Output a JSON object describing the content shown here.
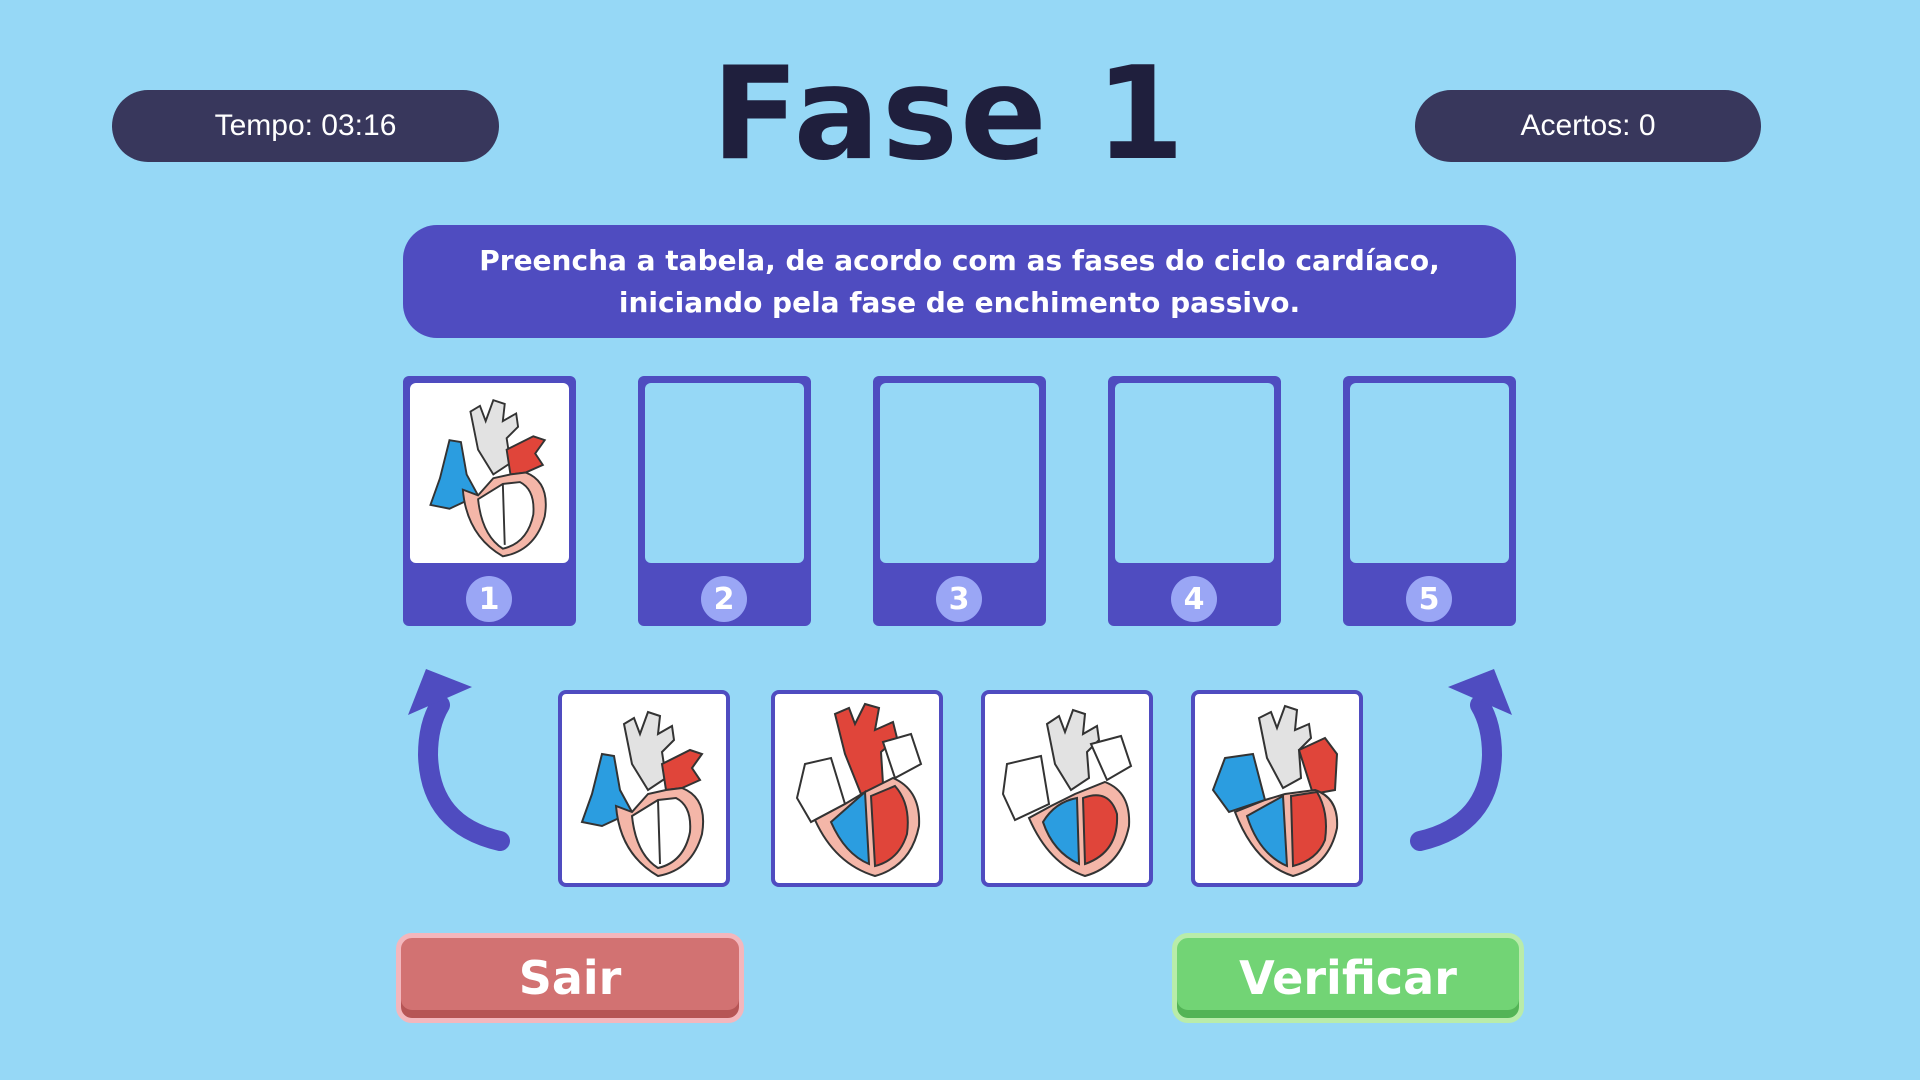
{
  "header": {
    "timer_text": "Tempo: 03:16",
    "title": "Fase 1",
    "score_text": "Acertos: 0"
  },
  "instruction": {
    "line1": "Preencha a tabela, de acordo com as fases do ciclo cardíaco,",
    "line2": "iniciando pela fase de enchimento passivo."
  },
  "slots": [
    {
      "number": "1",
      "filled": true
    },
    {
      "number": "2",
      "filled": false
    },
    {
      "number": "3",
      "filled": false
    },
    {
      "number": "4",
      "filled": false
    },
    {
      "number": "5",
      "filled": false
    }
  ],
  "cards": [
    {
      "icon": "heart-passive-filling-icon"
    },
    {
      "icon": "heart-ejection-icon"
    },
    {
      "icon": "heart-isovolumetric-icon"
    },
    {
      "icon": "heart-atrial-contraction-icon"
    }
  ],
  "buttons": {
    "exit_label": "Sair",
    "verify_label": "Verificar"
  },
  "colors": {
    "background": "#96d8f6",
    "pill": "#38375c",
    "accent": "#4f4cc0",
    "slot_number": "#9aa6f5",
    "exit": "#d27272",
    "verify": "#72d475"
  }
}
